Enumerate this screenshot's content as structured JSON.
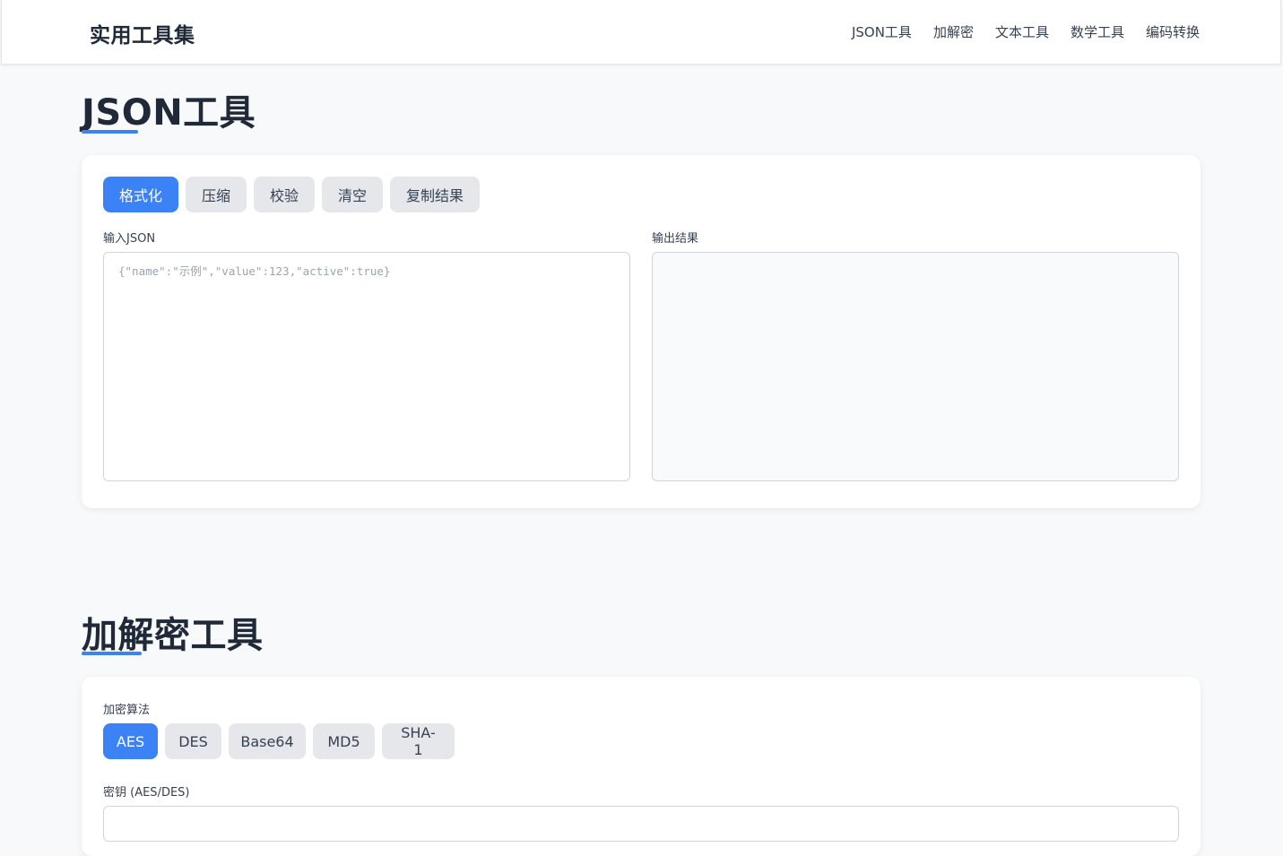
{
  "header": {
    "brand": "实用工具集",
    "nav": [
      "JSON工具",
      "加解密",
      "文本工具",
      "数学工具",
      "编码转换"
    ]
  },
  "json_tool": {
    "title": "JSON工具",
    "buttons": [
      "格式化",
      "压缩",
      "校验",
      "清空",
      "复制结果"
    ],
    "active_button": "格式化",
    "input_label": "输入JSON",
    "input_placeholder": "{\"name\":\"示例\",\"value\":123,\"active\":true}",
    "input_value": "",
    "output_label": "输出结果",
    "output_value": ""
  },
  "crypto_tool": {
    "title": "加解密工具",
    "algorithm_label": "加密算法",
    "algorithms": [
      "AES",
      "DES",
      "Base64",
      "MD5",
      "SHA-1"
    ],
    "active_algorithm": "AES",
    "key_label": "密钥 (AES/DES)",
    "key_value": ""
  },
  "colors": {
    "accent": "#3b82f6",
    "background": "#f8f9fb",
    "card": "#ffffff",
    "button_inactive": "#e5e7eb"
  }
}
